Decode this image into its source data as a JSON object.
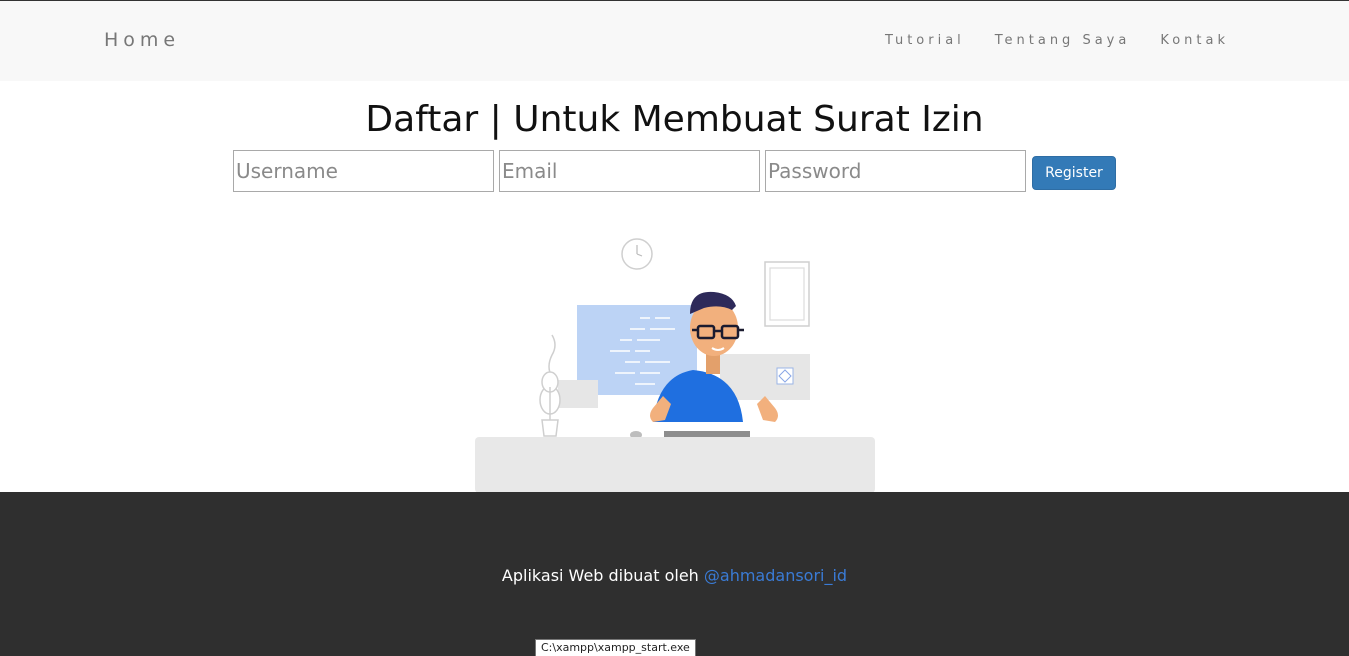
{
  "nav": {
    "brand": "Home",
    "links": [
      "Tutorial",
      "Tentang Saya",
      "Kontak"
    ]
  },
  "main": {
    "title": "Daftar | Untuk Membuat Surat Izin",
    "form": {
      "username_placeholder": "Username",
      "email_placeholder": "Email",
      "password_placeholder": "Password",
      "register_label": "Register"
    }
  },
  "footer": {
    "text": "Aplikasi Web dibuat oleh ",
    "link": "@ahmadansori_id"
  },
  "status_tooltip": "C:\\xampp\\xampp_start.exe",
  "colors": {
    "navbar_bg": "#f8f8f8",
    "button": "#337ab7",
    "footer_bg": "#2f2f2f",
    "link": "#3a7bd5"
  }
}
